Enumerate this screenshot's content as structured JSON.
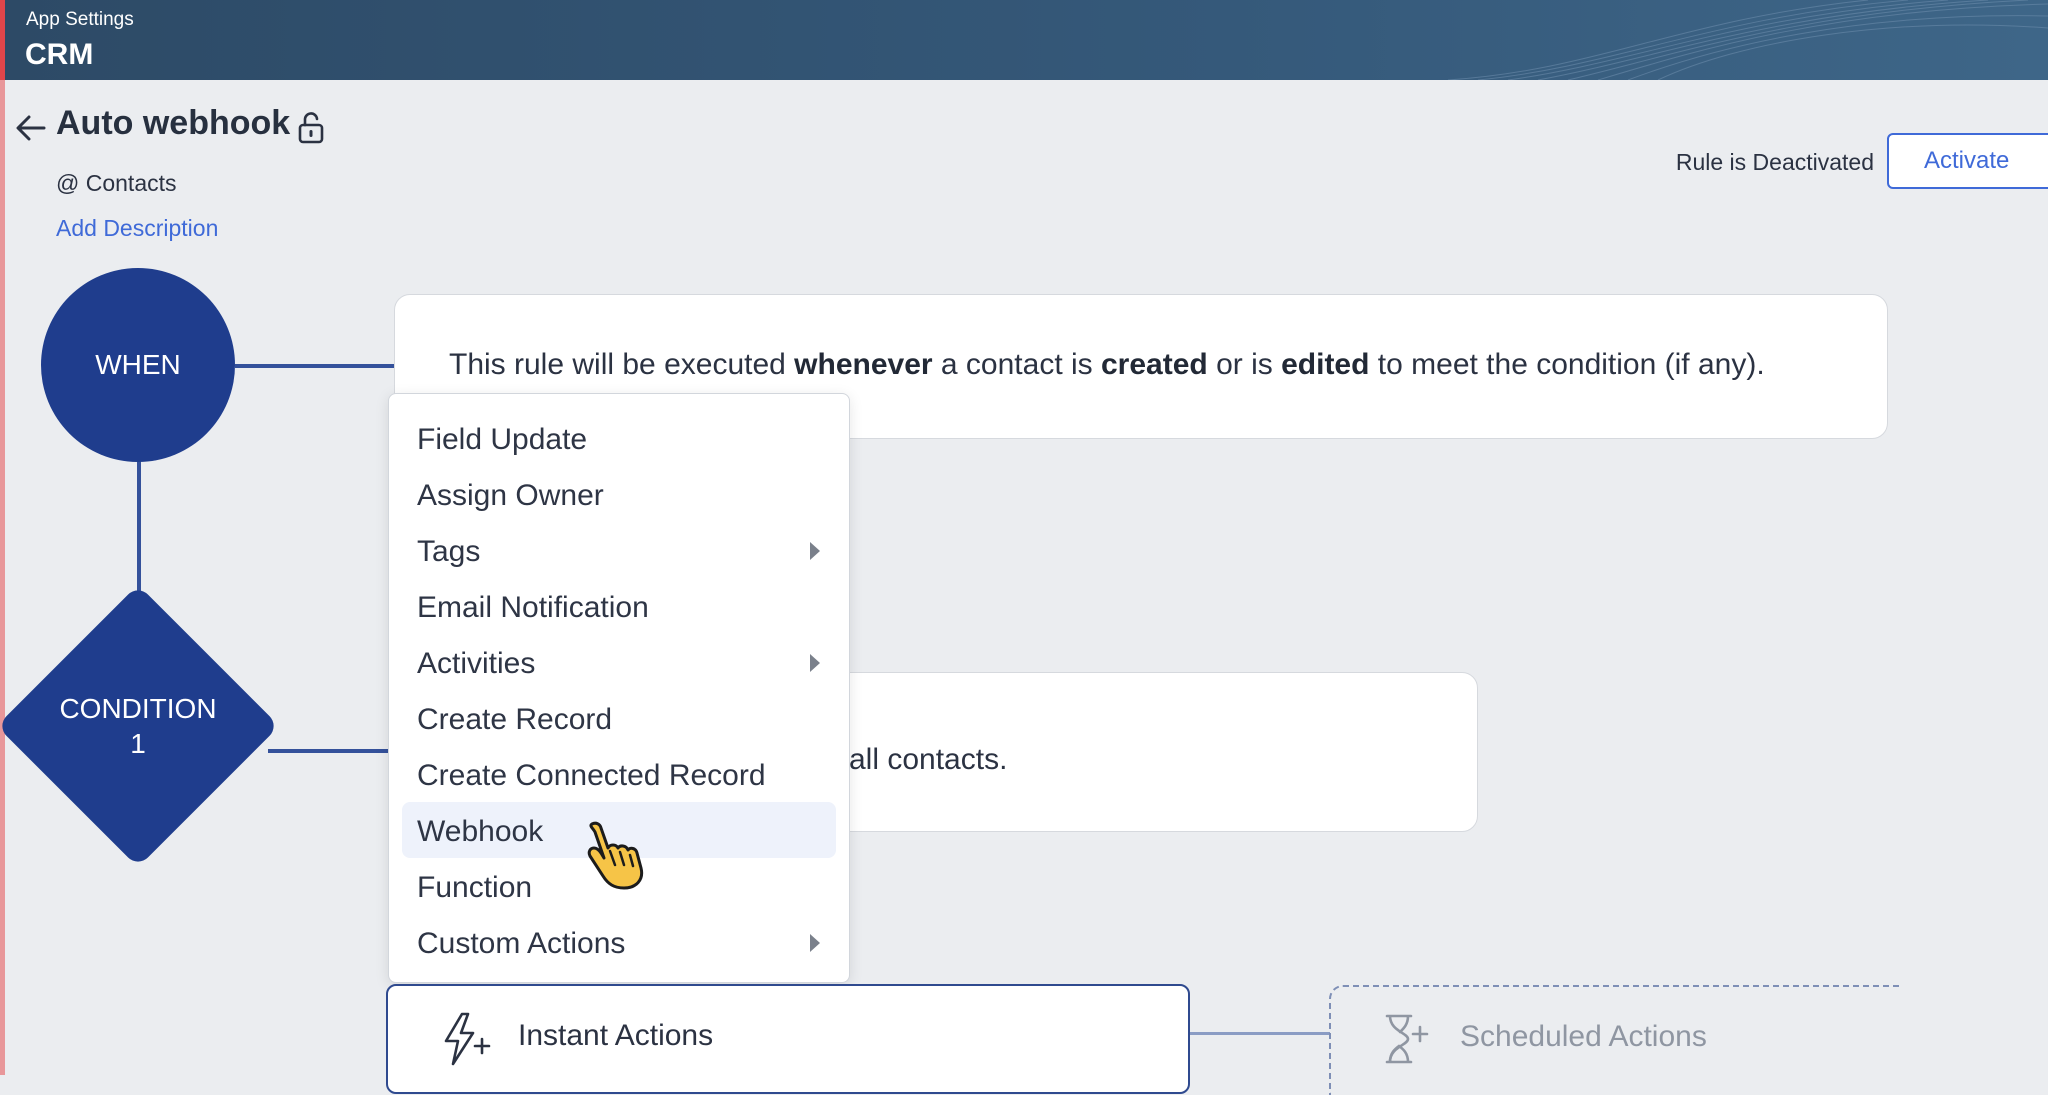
{
  "header": {
    "subtitle": "App Settings",
    "title": "CRM"
  },
  "rule": {
    "name": "Auto webhook",
    "module": "@ Contacts",
    "add_description": "Add Description",
    "status_text": "Rule is Deactivated",
    "activate_label": "Activate"
  },
  "when": {
    "node_label": "WHEN",
    "sentence": {
      "p1": "This rule will be executed ",
      "b1": "whenever",
      "p2": " a contact is ",
      "b2": "created",
      "p3": " or is ",
      "b3": "edited",
      "p4": " to meet the condition (if any)."
    }
  },
  "condition": {
    "line1": "CONDITION",
    "line2": "1",
    "text": "all contacts."
  },
  "action_menu": {
    "items": [
      {
        "label": "Field Update",
        "submenu": false
      },
      {
        "label": "Assign Owner",
        "submenu": false
      },
      {
        "label": "Tags",
        "submenu": true
      },
      {
        "label": "Email Notification",
        "submenu": false
      },
      {
        "label": "Activities",
        "submenu": true
      },
      {
        "label": "Create Record",
        "submenu": false
      },
      {
        "label": "Create Connected Record",
        "submenu": false
      },
      {
        "label": "Webhook",
        "submenu": false,
        "highlighted": true
      },
      {
        "label": "Function",
        "submenu": false
      },
      {
        "label": "Custom Actions",
        "submenu": true
      }
    ]
  },
  "actions": {
    "instant_label": "Instant Actions",
    "scheduled_label": "Scheduled Actions"
  },
  "colors": {
    "header_bg": "#2d4a66",
    "node_blue": "#1f3d8d",
    "link_blue": "#3f6ad8",
    "menu_highlight": "#eef2fb"
  },
  "icons": {
    "back": "arrow-left-icon",
    "lock": "unlock-icon",
    "submenu": "caret-right-icon",
    "instant": "lightning-plus-icon",
    "scheduled": "hourglass-plus-icon",
    "cursor": "hand-pointer-icon"
  }
}
